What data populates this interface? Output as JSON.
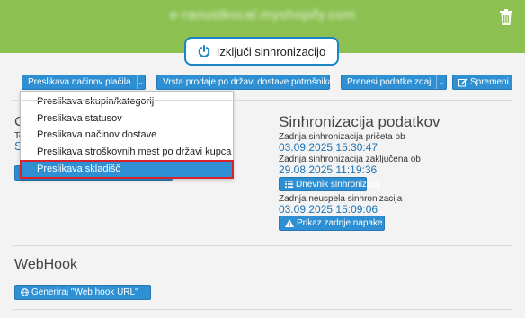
{
  "header": {
    "store_url": "e-raoustkocal.myshopify.com",
    "sync_toggle_label": "Izključi sinhronizacijo",
    "bg_color": "#8cc152"
  },
  "toolbar": {
    "mapping_dropdown_label": "Preslikava načinov plačila",
    "vat_button_label": "Vrsta prodaje po državi dostave potrošnika",
    "transfer_label": "Prenesi podatke zdaj",
    "save_label": "Spremeni"
  },
  "mapping_menu": {
    "items": [
      "Preslikava skupin/kategorij",
      "Preslikava statusov",
      "Preslikava načinov dostave",
      "Preslikava stroškovnih mest po državi kupca",
      "Preslikava skladišč"
    ],
    "selected": "Preslikava skladišč"
  },
  "partial_left": {
    "heading_fragment": "C",
    "label_fragment": "Te",
    "value_fragment": "S"
  },
  "sync_status": {
    "title": "Sinhronizacija podatkov",
    "last_start_label": "Zadnja sinhronizacija pričeta ob",
    "last_start_value": "03.09.2025 15:30:47",
    "last_end_label": "Zadnja sinhronizacija zaključena ob",
    "last_end_value": "29.08.2025 11:19:36",
    "log_button_label": "Dnevnik sinhronizacij",
    "last_fail_label": "Zadnja neuspela sinhronizacija",
    "last_fail_value": "03.09.2025 15:09:06",
    "error_button_label": "Prikaz zadnje napake"
  },
  "webhook": {
    "title": "WebHook",
    "generate_button_label": "Generiraj \"Web hook URL\""
  },
  "colors": {
    "accent": "#2e8fd3",
    "highlight_border": "#d9212b",
    "link_value": "#1b73b5"
  }
}
